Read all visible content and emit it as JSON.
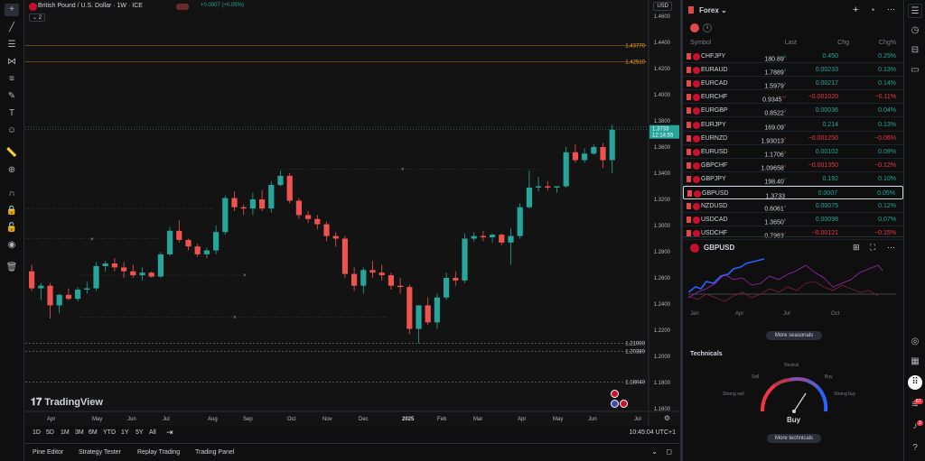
{
  "chart": {
    "symbol_title": "British Pound / U.S. Dollar · 1W · ICE",
    "change": "+0.0007 (+0.05%)",
    "indicator_count": "2",
    "currency": "USD",
    "watermark": "TradingView",
    "price_axis": [
      "1.4600",
      "1.4400",
      "1.4200",
      "1.4000",
      "1.3800",
      "1.3600",
      "1.3400",
      "1.3200",
      "1.3000",
      "1.2800",
      "1.2600",
      "1.2400",
      "1.2200",
      "1.2000",
      "1.1800",
      "1.1600"
    ],
    "level_labels": [
      {
        "label": "1.43770",
        "color": "#f7a21b"
      },
      {
        "label": "1.42510",
        "color": "#f7a21b"
      },
      {
        "label": "1.21000",
        "color": "#d1d4dc"
      },
      {
        "label": "1.20380",
        "color": "#d1d4dc"
      },
      {
        "label": "1.18040",
        "color": "#d1d4dc"
      }
    ],
    "current_price": "1.3733",
    "countdown": "12:14:55",
    "time_axis": [
      "Apr",
      "May",
      "Jun",
      "Jul",
      "Aug",
      "Sep",
      "Oct",
      "Nov",
      "Dec",
      "2025",
      "Feb",
      "Mar",
      "Apr",
      "May",
      "Jun",
      "Jul"
    ],
    "up_color": "#26a69a",
    "down_color": "#ef5350"
  },
  "timeframes": [
    "1D",
    "5D",
    "1M",
    "3M",
    "6M",
    "YTD",
    "1Y",
    "5Y",
    "All"
  ],
  "clock": "10:45:04 UTC+1",
  "bottom_tabs": [
    "Pine Editor",
    "Strategy Tester",
    "Replay Trading",
    "Trading Panel"
  ],
  "watchlist": {
    "title": "Forex",
    "columns": {
      "symbol": "Symbol",
      "last": "Last",
      "chg": "Chg",
      "pct": "Chg%"
    },
    "rows": [
      {
        "symbol": "CHFJPY",
        "last": "180.89",
        "sup": "6",
        "chg": "0.450",
        "pct": "0.25%",
        "dir": "up"
      },
      {
        "symbol": "EURAUD",
        "last": "1.7889",
        "sup": "3",
        "chg": "0.00233",
        "pct": "0.13%",
        "dir": "up"
      },
      {
        "symbol": "EURCAD",
        "last": "1.5979",
        "sup": "2",
        "chg": "0.00217",
        "pct": "0.14%",
        "dir": "up"
      },
      {
        "symbol": "EURCHF",
        "last": "0.9345",
        "sup": "70",
        "chg": "−0.001020",
        "pct": "−0.11%",
        "dir": "dn"
      },
      {
        "symbol": "EURGBP",
        "last": "0.8522",
        "sup": "3",
        "chg": "0.00036",
        "pct": "0.04%",
        "dir": "up"
      },
      {
        "symbol": "EURJPY",
        "last": "169.09",
        "sup": "0",
        "chg": "0.214",
        "pct": "0.13%",
        "dir": "up"
      },
      {
        "symbol": "EURNZD",
        "last": "1.93013",
        "sup": "0",
        "chg": "−0.001250",
        "pct": "−0.06%",
        "dir": "dn"
      },
      {
        "symbol": "EURUSD",
        "last": "1.1706",
        "sup": "3",
        "chg": "0.00102",
        "pct": "0.09%",
        "dir": "up"
      },
      {
        "symbol": "GBPCHF",
        "last": "1.09658",
        "sup": "0",
        "chg": "−0.001350",
        "pct": "−0.12%",
        "dir": "dn"
      },
      {
        "symbol": "GBPJPY",
        "last": "198.40",
        "sup": "7",
        "chg": "0.192",
        "pct": "0.10%",
        "dir": "up"
      },
      {
        "symbol": "GBPUSD",
        "last": "1.3733",
        "sup": "",
        "chg": "0.0007",
        "pct": "0.05%",
        "dir": "up"
      },
      {
        "symbol": "NZDUSD",
        "last": "0.6061",
        "sup": "4",
        "chg": "0.00075",
        "pct": "0.12%",
        "dir": "up"
      },
      {
        "symbol": "USDCAD",
        "last": "1.3650",
        "sup": "5",
        "chg": "0.00098",
        "pct": "0.07%",
        "dir": "up"
      },
      {
        "symbol": "USDCHF",
        "last": "0.7983",
        "sup": "7",
        "chg": "−0.00121",
        "pct": "−0.15%",
        "dir": "dn"
      }
    ]
  },
  "details": {
    "symbol": "GBPUSD",
    "seasonal_months": [
      "Jan",
      "Apr",
      "Jul",
      "Oct"
    ],
    "more_seasonals": "More seasonals",
    "technicals_title": "Technicals",
    "gauge_labels": {
      "neutral": "Neutral",
      "sell": "Sell",
      "buy": "Buy",
      "strong_sell": "Strong sell",
      "strong_buy": "Strong buy"
    },
    "verdict": "Buy",
    "more_technicals": "More technicals"
  },
  "badges": {
    "alerts": "67",
    "notifications": "2"
  }
}
